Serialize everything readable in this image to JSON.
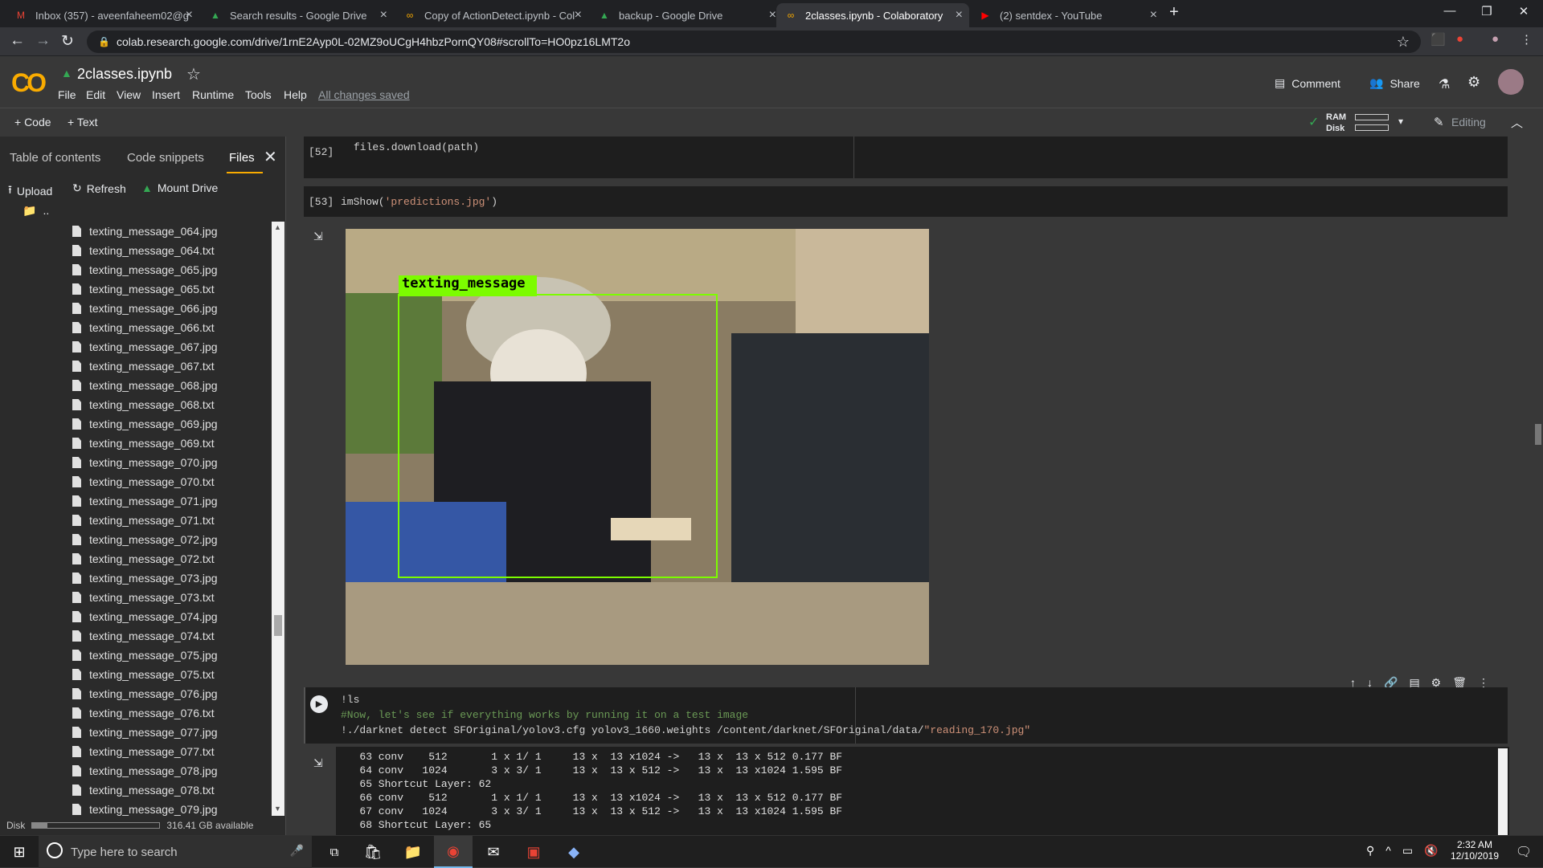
{
  "browser": {
    "tabs": [
      {
        "title": "Inbox (357) - aveenfaheem02@g",
        "icon": "gmail-icon",
        "color": "#ea4335"
      },
      {
        "title": "Search results - Google Drive",
        "icon": "drive-icon",
        "color": "#34a853"
      },
      {
        "title": "Copy of ActionDetect.ipynb - Col",
        "icon": "colab-icon",
        "color": "#f9ab00"
      },
      {
        "title": "backup - Google Drive",
        "icon": "drive-icon",
        "color": "#34a853"
      },
      {
        "title": "2classes.ipynb - Colaboratory",
        "icon": "colab-icon",
        "color": "#f9ab00"
      },
      {
        "title": "(2) sentdex - YouTube",
        "icon": "youtube-icon",
        "color": "#ff0000"
      }
    ],
    "url": "colab.research.google.com/drive/1rnE2Ayp0L-02MZ9oUCgH4hbzPornQY08#scrollTo=HO0pz16LMT2o"
  },
  "colab": {
    "logo": "CO",
    "notebook_title": "2classes.ipynb",
    "menu": [
      "File",
      "Edit",
      "View",
      "Insert",
      "Runtime",
      "Tools",
      "Help"
    ],
    "save_status": "All changes saved",
    "comment": "Comment",
    "share": "Share",
    "add_code": "+ Code",
    "add_text": "+ Text",
    "ram": "RAM",
    "disk": "Disk",
    "editing": "Editing"
  },
  "sidebar": {
    "tabs": [
      "Table of contents",
      "Code snippets",
      "Files"
    ],
    "upload": "Upload",
    "refresh": "Refresh",
    "mount": "Mount Drive",
    "parent": "..",
    "files": [
      "texting_message_064.jpg",
      "texting_message_064.txt",
      "texting_message_065.jpg",
      "texting_message_065.txt",
      "texting_message_066.jpg",
      "texting_message_066.txt",
      "texting_message_067.jpg",
      "texting_message_067.txt",
      "texting_message_068.jpg",
      "texting_message_068.txt",
      "texting_message_069.jpg",
      "texting_message_069.txt",
      "texting_message_070.jpg",
      "texting_message_070.txt",
      "texting_message_071.jpg",
      "texting_message_071.txt",
      "texting_message_072.jpg",
      "texting_message_072.txt",
      "texting_message_073.jpg",
      "texting_message_073.txt",
      "texting_message_074.jpg",
      "texting_message_074.txt",
      "texting_message_075.jpg",
      "texting_message_075.txt",
      "texting_message_076.jpg",
      "texting_message_076.txt",
      "texting_message_077.jpg",
      "texting_message_077.txt",
      "texting_message_078.jpg",
      "texting_message_078.txt",
      "texting_message_079.jpg"
    ],
    "disk_label": "Disk",
    "disk_available": "316.41 GB available",
    "disk_used_fraction": 0.12
  },
  "cells": {
    "c52": {
      "num": "[52]",
      "line1": "files.download(path)"
    },
    "c53": {
      "num": "[53]",
      "fn": "imShow(",
      "arg": "'predictions.jpg'",
      "close": ")"
    },
    "detection_label": "texting_message",
    "c54": {
      "line1": "!ls",
      "line2": "#Now, let's see if everything works by running it on a test image",
      "line3a": "!./darknet detect SFOriginal/yolov3.cfg yolov3_1660.weights /content/darknet/SFOriginal/data/",
      "line3b": "\"reading_170.jpg\""
    },
    "output_lines": [
      "   63 conv    512       1 x 1/ 1     13 x  13 x1024 ->   13 x  13 x 512 0.177 BF",
      "   64 conv   1024       3 x 3/ 1     13 x  13 x 512 ->   13 x  13 x1024 1.595 BF",
      "   65 Shortcut Layer: 62",
      "   66 conv    512       1 x 1/ 1     13 x  13 x1024 ->   13 x  13 x 512 0.177 BF",
      "   67 conv   1024       3 x 3/ 1     13 x  13 x 512 ->   13 x  13 x1024 1.595 BF",
      "   68 Shortcut Layer: 65"
    ]
  },
  "taskbar": {
    "search_placeholder": "Type here to search",
    "time": "2:32 AM",
    "date": "12/10/2019"
  }
}
